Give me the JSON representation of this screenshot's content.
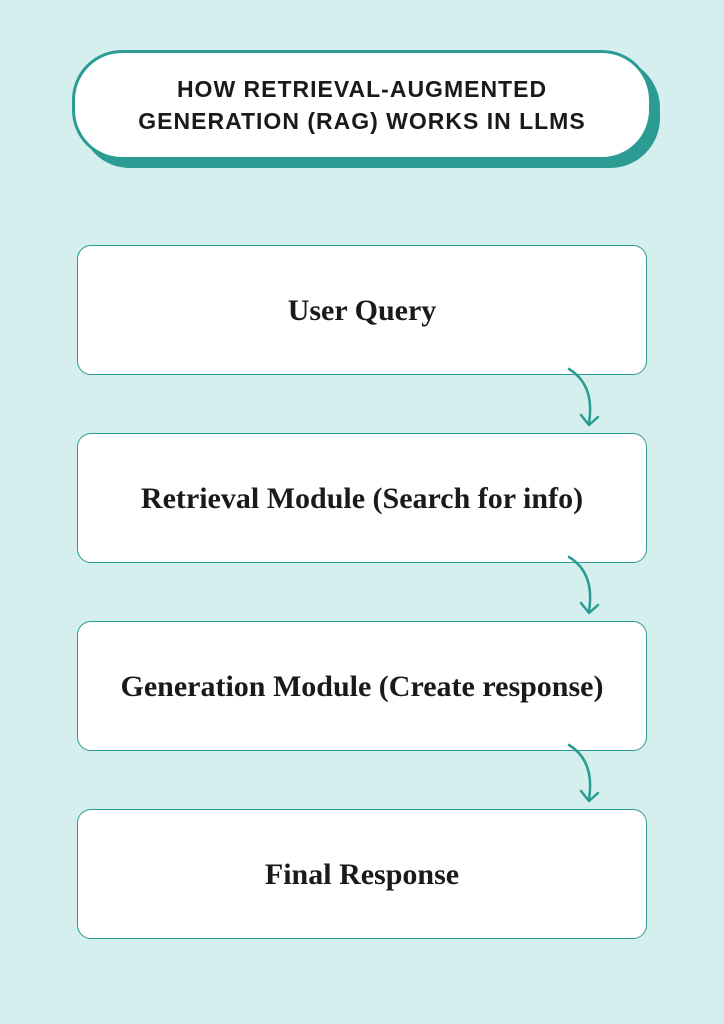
{
  "title": "HOW RETRIEVAL-AUGMENTED GENERATION (RAG) WORKS IN LLMS",
  "steps": [
    {
      "label": "User Query"
    },
    {
      "label": "Retrieval Module (Search for info)"
    },
    {
      "label": "Generation Module (Create response)"
    },
    {
      "label": "Final Response"
    }
  ],
  "colors": {
    "background": "#d5eeee",
    "accent": "#2b9b94",
    "boxFill": "#ffffff",
    "text": "#1a1a1a"
  }
}
